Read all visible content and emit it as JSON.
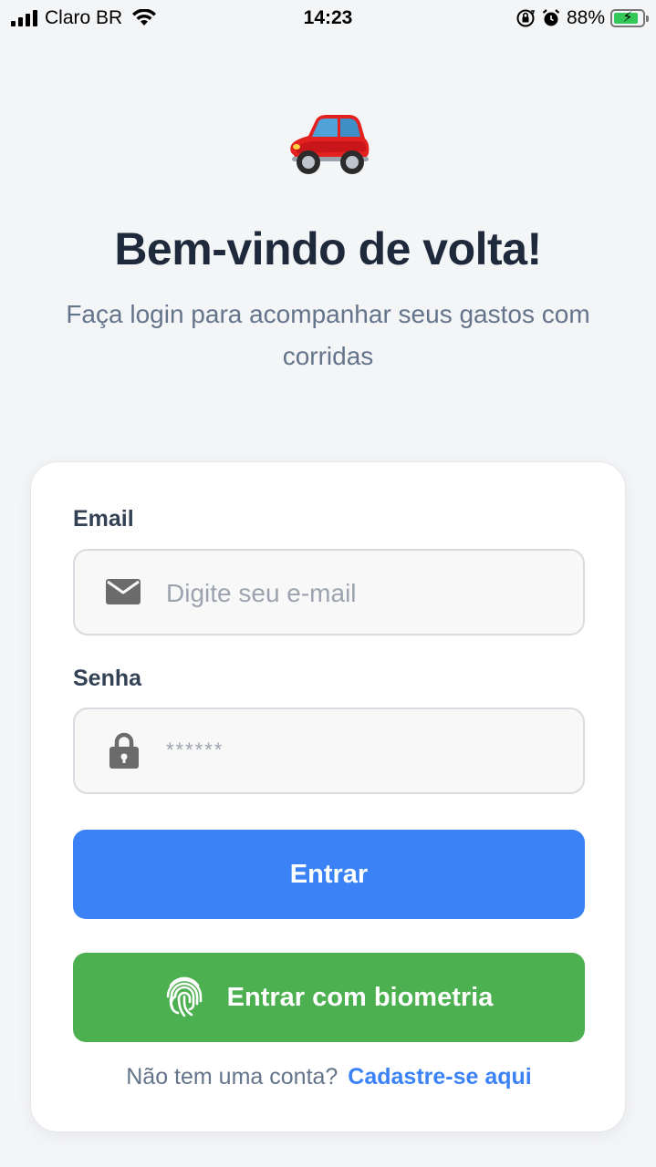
{
  "status_bar": {
    "carrier": "Claro BR",
    "time": "14:23",
    "battery_percent": "88%",
    "battery_level": 0.88
  },
  "hero": {
    "icon": "red-car-emoji",
    "title": "Bem-vindo de volta!",
    "subtitle": "Faça login para acompanhar seus gastos com corridas"
  },
  "form": {
    "email": {
      "label": "Email",
      "placeholder": "Digite seu e-mail",
      "icon": "envelope-icon"
    },
    "password": {
      "label": "Senha",
      "placeholder": "******",
      "icon": "lock-icon"
    },
    "submit_label": "Entrar",
    "biometric_label": "Entrar com biometria",
    "biometric_icon": "fingerprint-icon"
  },
  "footer": {
    "prompt": "Não tem uma conta?",
    "signup_link": "Cadastre-se aqui"
  },
  "colors": {
    "primary": "#3b82f6",
    "success": "#4caf50",
    "title": "#1e293b",
    "muted": "#64748b",
    "background": "#f4f5f7"
  }
}
